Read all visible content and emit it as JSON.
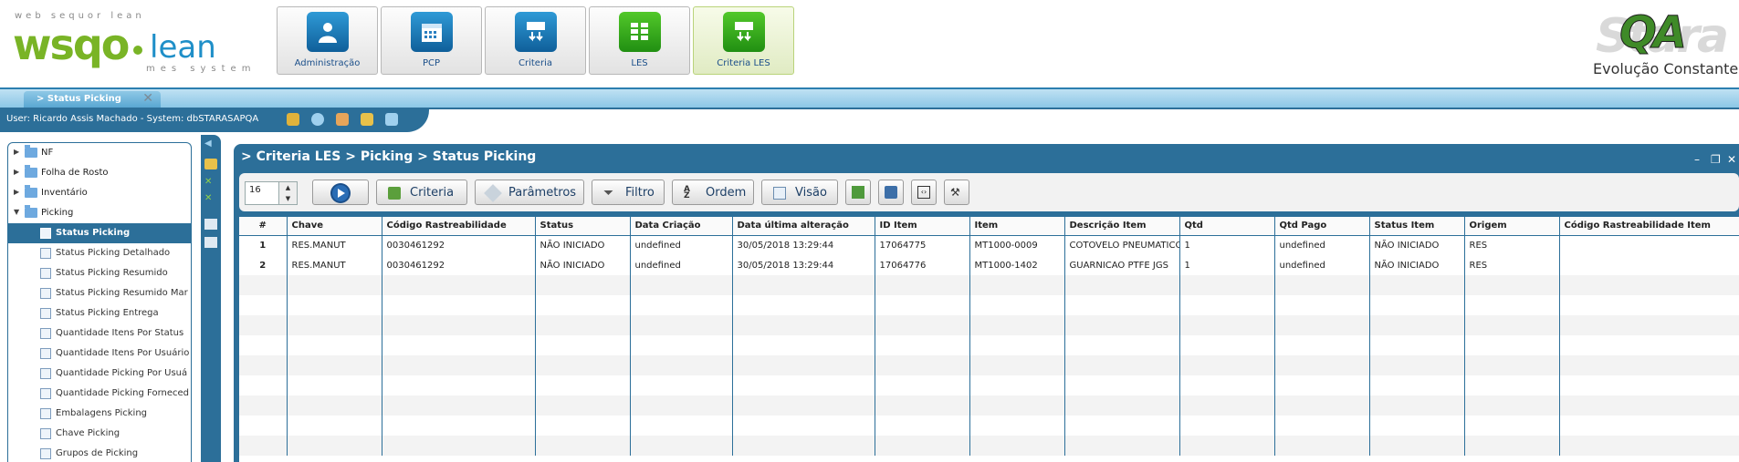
{
  "header": {
    "logo": {
      "top": "web sequor lean",
      "main": "wsqo",
      "lean": "lean",
      "sub": "mes system"
    },
    "menu": [
      {
        "label": "Administração",
        "icon": "user-icon",
        "color": "blue"
      },
      {
        "label": "PCP",
        "icon": "calendar-icon",
        "color": "blue"
      },
      {
        "label": "Criteria",
        "icon": "criteria-icon",
        "color": "blue"
      },
      {
        "label": "LES",
        "icon": "les-grid-icon",
        "color": "green"
      },
      {
        "label": "Criteria LES",
        "icon": "criteria-les-icon",
        "color": "green",
        "active": true
      }
    ],
    "qa_logo": {
      "bg": "Stara",
      "main": "QA",
      "sub": "Evolução Constante"
    }
  },
  "tabs": [
    {
      "label": "> Status Picking"
    }
  ],
  "userbar": {
    "text": "User: Ricardo Assis Machado - System: dbSTARASAPQA"
  },
  "tree": {
    "folders": [
      {
        "label": "NF",
        "expanded": false
      },
      {
        "label": "Folha de Rosto",
        "expanded": false
      },
      {
        "label": "Inventário",
        "expanded": false
      },
      {
        "label": "Picking",
        "expanded": true
      }
    ],
    "items": [
      {
        "label": "Status Picking",
        "selected": true
      },
      {
        "label": "Status Picking Detalhado"
      },
      {
        "label": "Status Picking Resumido"
      },
      {
        "label": "Status Picking Resumido Mar"
      },
      {
        "label": "Status Picking Entrega"
      },
      {
        "label": "Quantidade Itens Por Status"
      },
      {
        "label": "Quantidade Itens Por Usuário"
      },
      {
        "label": "Quantidade Picking Por Usuá"
      },
      {
        "label": "Quantidade Picking Forneced"
      },
      {
        "label": "Embalagens Picking"
      },
      {
        "label": "Chave Picking"
      },
      {
        "label": "Grupos de Picking"
      }
    ]
  },
  "main": {
    "breadcrumb": "> Criteria LES > Picking > Status Picking",
    "toolbar": {
      "page_size": "16",
      "buttons": {
        "criteria": "Criteria",
        "parametros": "Parâmetros",
        "filtro": "Filtro",
        "ordem": "Ordem",
        "visao": "Visão"
      }
    },
    "grid": {
      "columns": [
        "#",
        "Chave",
        "Código Rastreabilidade",
        "Status",
        "Data Criação",
        "Data última alteração",
        "ID Item",
        "Item",
        "Descrição Item",
        "Qtd",
        "Qtd Pago",
        "Status Item",
        "Origem",
        "Código Rastreabilidade Item"
      ],
      "rows": [
        [
          "1",
          "RES.MANUT",
          "0030461292",
          "NÃO INICIADO",
          "undefined",
          "30/05/2018 13:29:44",
          "17064775",
          "MT1000-0009",
          "COTOVELO PNEUMATICO",
          "1",
          "undefined",
          "NÃO INICIADO",
          "RES",
          ""
        ],
        [
          "2",
          "RES.MANUT",
          "0030461292",
          "NÃO INICIADO",
          "undefined",
          "30/05/2018 13:29:44",
          "17064776",
          "MT1000-1402",
          "GUARNICAO PTFE JGS",
          "1",
          "undefined",
          "NÃO INICIADO",
          "RES",
          ""
        ]
      ]
    }
  }
}
